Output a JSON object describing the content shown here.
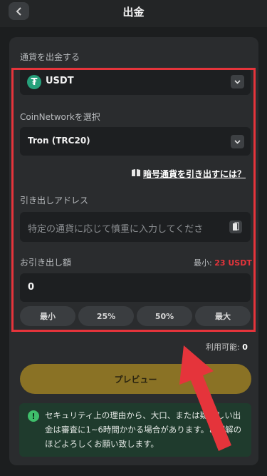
{
  "header": {
    "title": "出金"
  },
  "currency": {
    "label": "通貨を出金する",
    "value": "USDT",
    "icon": "tether-icon"
  },
  "network": {
    "label": "CoinNetworkを選択",
    "value": "Tron (TRC20)"
  },
  "help_link": "暗号通貨を引き出すには？",
  "address": {
    "label": "引き出しアドレス",
    "placeholder": "特定の通貨に応じて慎重に入力してくださ"
  },
  "amount": {
    "label": "お引き出し額",
    "min_label": "最小:",
    "min_value": "23 USDT",
    "value": "0",
    "quick_buttons": [
      "最小",
      "25%",
      "50%",
      "最大"
    ]
  },
  "available": {
    "label": "利用可能:",
    "value": "0"
  },
  "preview_button": "プレビュー",
  "notice": {
    "text": "セキュリティ上の理由から、大口、または疑わしい出金は審査に1~6時間かかる場合があります。ご理解のほどよろしくお願い致します。"
  },
  "colors": {
    "accent": "#8a7225",
    "highlight": "#e5343b",
    "tether": "#26a17b",
    "notice_bg": "#1f3b2d"
  }
}
